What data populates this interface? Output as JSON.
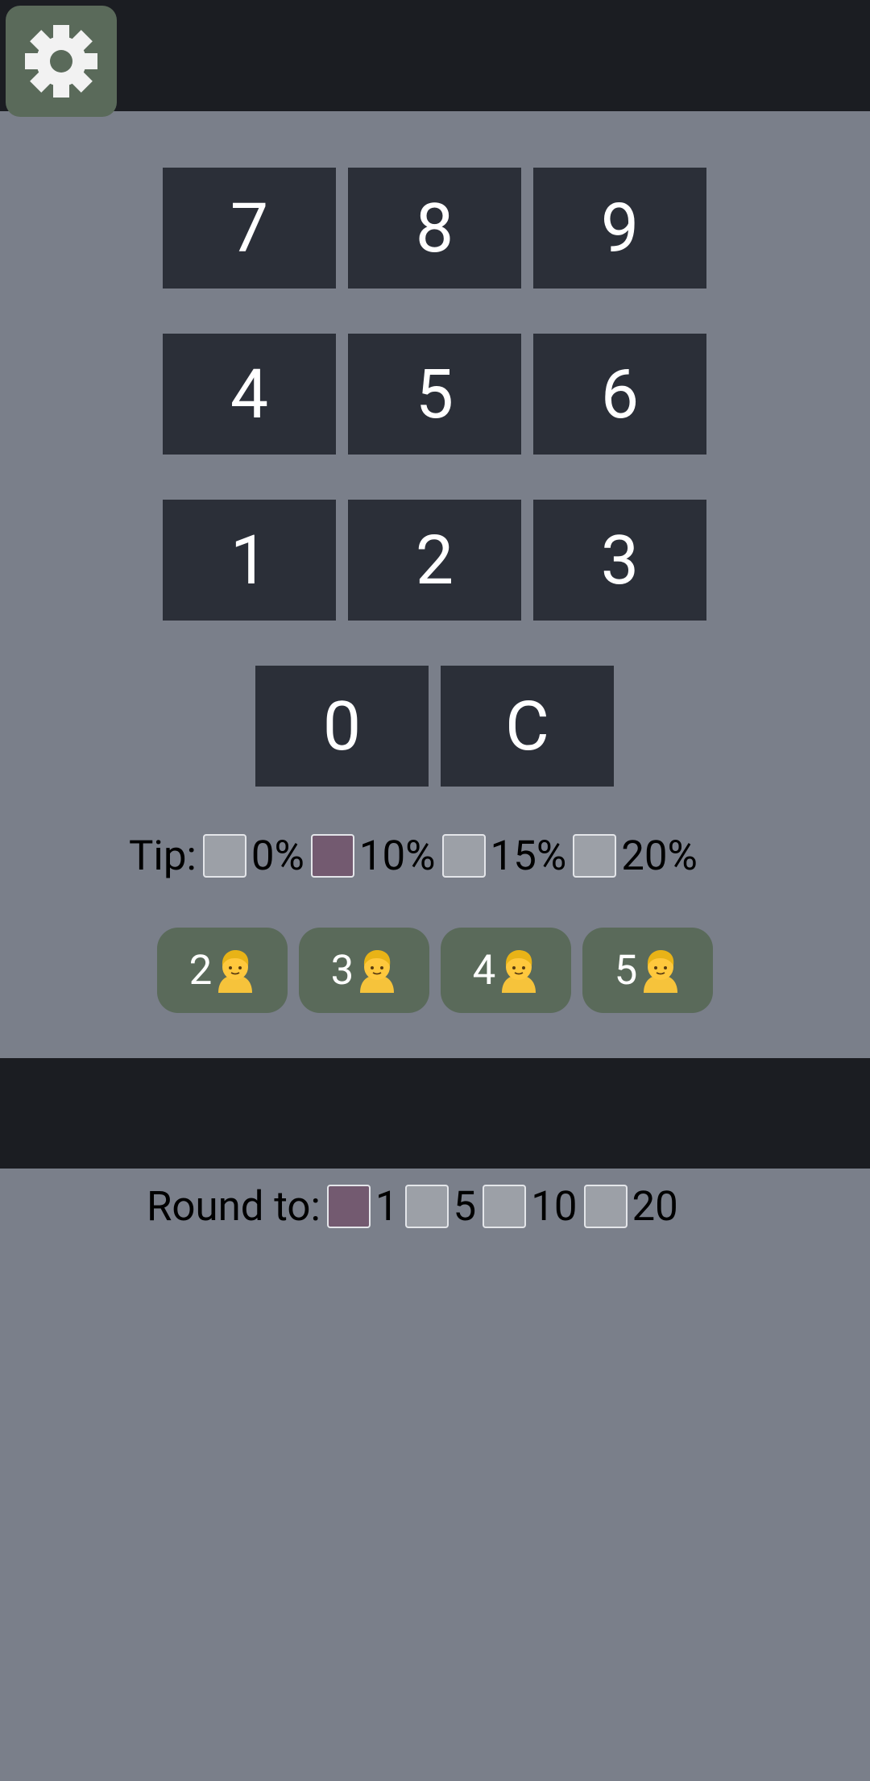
{
  "header": {
    "settings_icon": "gear-icon"
  },
  "keypad": {
    "keys": [
      "7",
      "8",
      "9",
      "4",
      "5",
      "6",
      "1",
      "2",
      "3",
      "0",
      "C"
    ]
  },
  "tip": {
    "label": "Tip:",
    "options": [
      {
        "label": "0%",
        "checked": false
      },
      {
        "label": "10%",
        "checked": true
      },
      {
        "label": "15%",
        "checked": false
      },
      {
        "label": "20%",
        "checked": false
      }
    ]
  },
  "split": {
    "icon": "person-icon",
    "buttons": [
      {
        "label": "2"
      },
      {
        "label": "3"
      },
      {
        "label": "4"
      },
      {
        "label": "5"
      }
    ]
  },
  "result": {
    "text": ""
  },
  "round": {
    "label": "Round to:",
    "options": [
      {
        "label": "1",
        "checked": true
      },
      {
        "label": "5",
        "checked": false
      },
      {
        "label": "10",
        "checked": false
      },
      {
        "label": "20",
        "checked": false
      }
    ]
  },
  "colors": {
    "background": "#7a7f8a",
    "bar": "#1b1d22",
    "key": "#2b2f38",
    "green_button": "#5a6a5a",
    "checkbox_unchecked": "#9ca0a7",
    "checkbox_checked": "#735a70"
  }
}
